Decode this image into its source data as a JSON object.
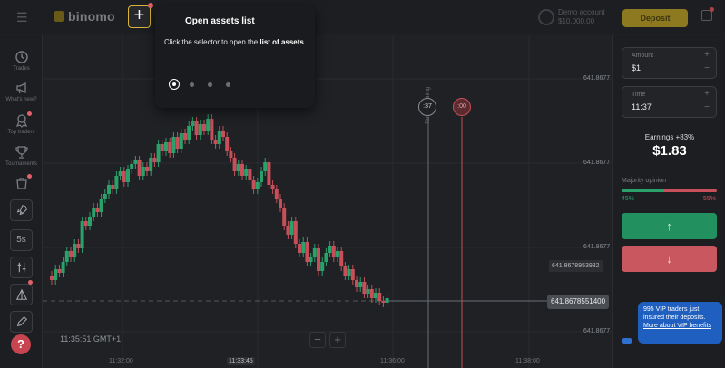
{
  "topbar": {
    "logo": "binomo",
    "add_label": "+",
    "account_line1": "Demo account",
    "account_line2": "$10,000.00",
    "deposit_label": "Deposit"
  },
  "sidebar": {
    "items": [
      {
        "label": "Trades",
        "icon": "clock-icon"
      },
      {
        "label": "What's new?",
        "icon": "megaphone-icon"
      },
      {
        "label": "Top traders",
        "icon": "award-icon"
      },
      {
        "label": "Tournaments",
        "icon": "trophy-icon"
      },
      {
        "label": "",
        "icon": "shop-icon"
      }
    ],
    "tools": [
      {
        "label": "",
        "icon": "rocket-icon"
      },
      {
        "label": "5s",
        "icon": ""
      },
      {
        "label": "",
        "icon": "indicators-icon"
      },
      {
        "label": "",
        "icon": "drawing-icon"
      },
      {
        "label": "",
        "icon": "pencil-icon"
      }
    ],
    "help_label": "?"
  },
  "chart": {
    "price_ticks": [
      "641.8677",
      "641.8677",
      "641.8677",
      "641.8677",
      "641.8677"
    ],
    "price_line_label": "641.8678953932",
    "current_price_label": "641.8678551400",
    "clock": "11:35:51 GMT+1",
    "zoom_out": "−",
    "zoom_in": "+",
    "time_ticks": [
      "11:32:00",
      "11:33:45",
      "11:36:00",
      "11:38:00"
    ],
    "time_remaining": "Time remaining",
    "purchase_marker": ":37",
    "expiry_marker": ":00",
    "colors": {
      "up": "#2aa06b",
      "down": "#c64f59"
    }
  },
  "tour": {
    "title": "Open assets list",
    "body_prefix": "Click the selector to open the ",
    "body_bold": "list of assets",
    "body_suffix": "."
  },
  "panel": {
    "amount_label": "Amount",
    "amount_value": "$1",
    "time_label": "Time",
    "time_value": "11:37",
    "plus": "+",
    "minus": "−",
    "earnings_label": "Earnings +83%",
    "earnings_value": "$1.83",
    "majority_label": "Majority opinion",
    "majority_up": 0.45,
    "pct_up": "45%",
    "pct_down": "55%",
    "up_icon": "↑",
    "down_icon": "↓"
  },
  "vip": {
    "text": "995 VIP traders just insured their deposits.",
    "link": "More about VIP benefits"
  }
}
